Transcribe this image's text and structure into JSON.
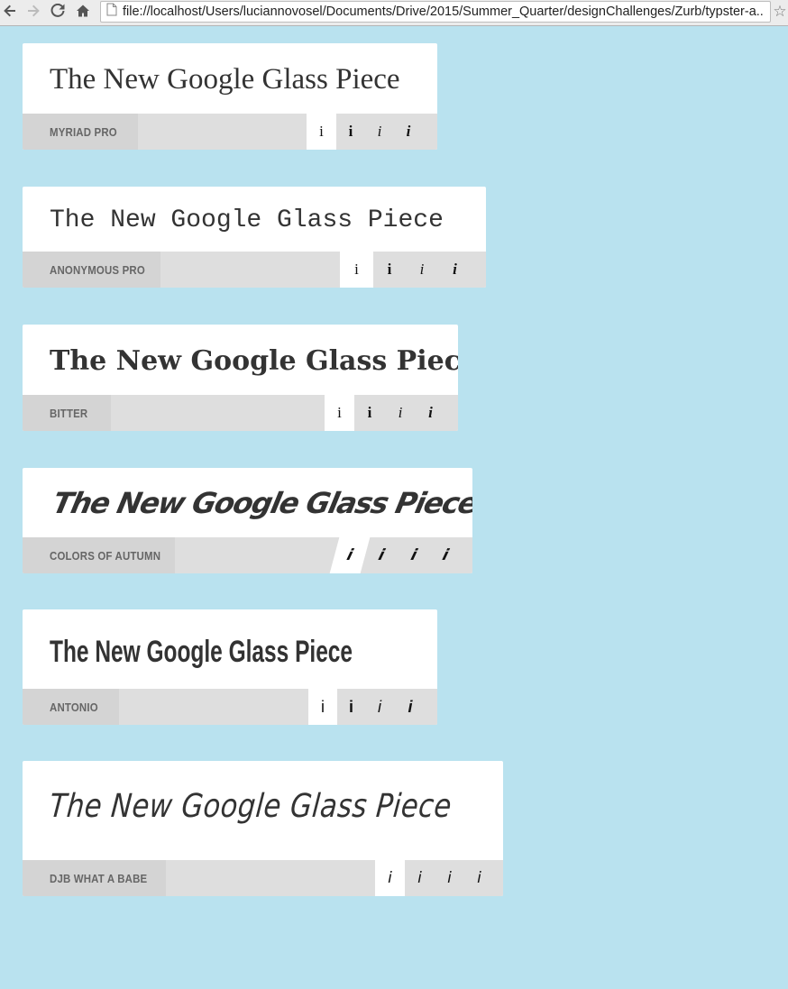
{
  "browser": {
    "url": "file://localhost/Users/luciannovosel/Documents/Drive/2015/Summer_Quarter/designChallenges/Zurb/typster-a...",
    "back_icon": "back-arrow-icon",
    "forward_icon": "forward-arrow-icon",
    "reload_icon": "reload-icon",
    "home_icon": "home-icon",
    "page_icon": "page-icon",
    "bookmark_icon": "star-icon"
  },
  "colors": {
    "background": "#b9e2ef",
    "card": "#ffffff",
    "bar": "#dedede",
    "name_cell": "#d4d4d4",
    "text": "#333333"
  },
  "cards": [
    {
      "preview": "The New Google Glass Piece",
      "font_name": "MYRIAD PRO",
      "styles": [
        "i",
        "i",
        "i",
        "i"
      ]
    },
    {
      "preview": "The New Google Glass Piece",
      "font_name": "ANONYMOUS PRO",
      "styles": [
        "i",
        "i",
        "i",
        "i"
      ]
    },
    {
      "preview": "The New Google Glass Piece",
      "font_name": "BITTER",
      "styles": [
        "i",
        "i",
        "i",
        "i"
      ]
    },
    {
      "preview": "The New Google Glass Piece",
      "font_name": "COLORS OF AUTUMN",
      "styles": [
        "i",
        "i",
        "i",
        "i"
      ]
    },
    {
      "preview": "The New Google Glass Piece",
      "font_name": "ANTONIO",
      "styles": [
        "i",
        "i",
        "i",
        "i"
      ]
    },
    {
      "preview": "The New Google Glass Piece",
      "font_name": "DJB WHAT A BABE",
      "styles": [
        "i",
        "i",
        "i",
        "i"
      ]
    }
  ]
}
